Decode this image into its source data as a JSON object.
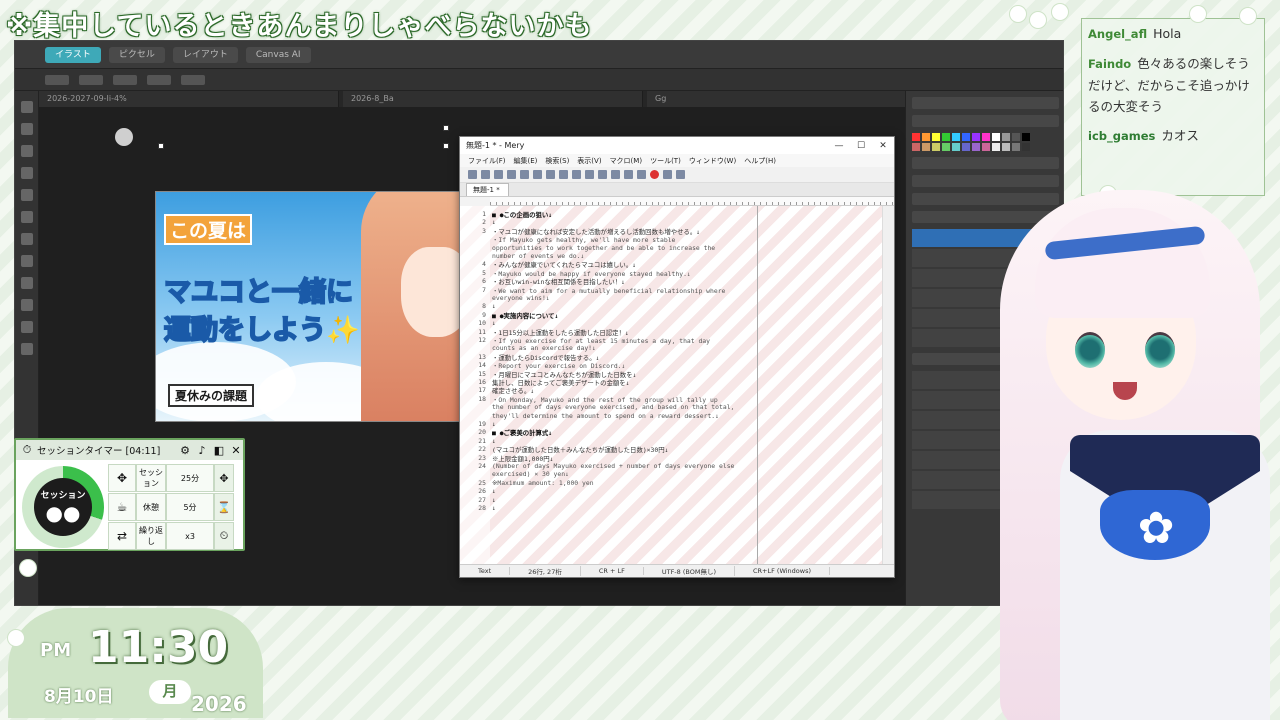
{
  "banner": "※集中しているときあんまりしゃべらないかも",
  "app": {
    "tabs": [
      "イラスト",
      "ピクセル",
      "レイアウト",
      "Canvas AI"
    ],
    "doc_tabs": [
      "2026-2027-09-Ii-4%",
      "2026-8_Ba",
      "Gg"
    ]
  },
  "artwork": {
    "line1": "この夏は",
    "line2": "マユコと一緒に",
    "line3": "運動をしよう✨",
    "tag": "夏休みの課題"
  },
  "editor": {
    "title": "無題-1 * - Mery",
    "menu": [
      "ファイル(F)",
      "編集(E)",
      "検索(S)",
      "表示(V)",
      "マクロ(M)",
      "ツール(T)",
      "ウィンドウ(W)",
      "ヘルプ(H)"
    ],
    "tab": "無題-1 *",
    "lines": [
      {
        "n": "1",
        "t": "■ ●この企画の狙い↓",
        "k": "h"
      },
      {
        "n": "2",
        "t": "↓",
        "k": ""
      },
      {
        "n": "3",
        "t": "・マユコが健康になれば安定した活動が増えるし活動回数も増やせる。↓",
        "k": ""
      },
      {
        "n": "",
        "t": "  ・If Mayuko gets healthy, we'll have more stable",
        "k": "en"
      },
      {
        "n": "",
        "t": "opportunities to work together and be able to increase the",
        "k": "en"
      },
      {
        "n": "",
        "t": "number of events we do.↓",
        "k": "en"
      },
      {
        "n": "4",
        "t": "・みんなが健康でいてくれたらマユコは嬉しい。↓",
        "k": ""
      },
      {
        "n": "5",
        "t": "  ・Mayuko would be happy if everyone stayed healthy.↓",
        "k": "en"
      },
      {
        "n": "6",
        "t": "・お互いwin-winな相互関係を目指したい！↓",
        "k": ""
      },
      {
        "n": "7",
        "t": "  ・We want to aim for a mutually beneficial relationship where",
        "k": "en"
      },
      {
        "n": "",
        "t": "everyone wins!↓",
        "k": "en"
      },
      {
        "n": "8",
        "t": "↓",
        "k": ""
      },
      {
        "n": "9",
        "t": "■ ●実施内容について↓",
        "k": "h"
      },
      {
        "n": "10",
        "t": "↓",
        "k": ""
      },
      {
        "n": "11",
        "t": "・1日15分以上運動をしたら運動した日認定！↓",
        "k": ""
      },
      {
        "n": "12",
        "t": "  ・If you exercise for at least 15 minutes a day, that day",
        "k": "en"
      },
      {
        "n": "",
        "t": "counts as an exercise day!↓",
        "k": "en"
      },
      {
        "n": "13",
        "t": "・運動したらDiscordで報告する。↓",
        "k": ""
      },
      {
        "n": "14",
        "t": "  ・Report your exercise on Discord.↓",
        "k": "en"
      },
      {
        "n": "15",
        "t": "・月曜日にマユコとみんなたちが運動した日数を↓",
        "k": ""
      },
      {
        "n": "16",
        "t": "集計し、日数によってご褒美デザートの金額を↓",
        "k": ""
      },
      {
        "n": "17",
        "t": "確定させる。↓",
        "k": ""
      },
      {
        "n": "18",
        "t": "  ・On Monday, Mayuko and the rest of the group will tally up",
        "k": "en"
      },
      {
        "n": "",
        "t": "the number of days everyone exercised, and based on that total,",
        "k": "en"
      },
      {
        "n": "",
        "t": "they'll determine the amount to spend on a reward dessert.↓",
        "k": "en"
      },
      {
        "n": "19",
        "t": "↓",
        "k": ""
      },
      {
        "n": "20",
        "t": "■ ●ご褒美の計算式↓",
        "k": "h"
      },
      {
        "n": "21",
        "t": "↓",
        "k": ""
      },
      {
        "n": "22",
        "t": "(マユコが運動した日数＋みんなたちが運動した日数)×30円↓",
        "k": ""
      },
      {
        "n": "23",
        "t": "※上限金額1,000円↓",
        "k": ""
      },
      {
        "n": "24",
        "t": "(Number of days Mayuko exercised + number of days everyone else",
        "k": "en"
      },
      {
        "n": "",
        "t": "exercised) × 30 yen↓",
        "k": "en"
      },
      {
        "n": "25",
        "t": "※Maximum amount: 1,000 yen",
        "k": "en"
      },
      {
        "n": "26",
        "t": "↓",
        "k": ""
      },
      {
        "n": "27",
        "t": "↓",
        "k": ""
      },
      {
        "n": "28",
        "t": "↓",
        "k": ""
      }
    ],
    "status": [
      "Text",
      "26行, 27桁",
      "CR + LF",
      "UTF-8 (BOM無し)",
      "CR+LF (Windows)"
    ]
  },
  "timer": {
    "title": "セッションタイマー [04:11]",
    "ring_label": "セッション",
    "progress_fraction": 0.3,
    "rows": [
      {
        "label": "セッション",
        "value": "25分"
      },
      {
        "label": "休憩",
        "value": "5分"
      },
      {
        "label": "繰り返し",
        "value": "x3"
      }
    ]
  },
  "clock": {
    "ampm": "PM",
    "time": "11:30",
    "date": "8月10日",
    "dow": "月",
    "year": "2026"
  },
  "chat": [
    {
      "name": "Angel_afl",
      "text": "Hola"
    },
    {
      "name": "Faindo",
      "text": "色々あるの楽しそうだけど、だからこそ追っかけるの大変そう"
    },
    {
      "name": "icb_games",
      "text": "カオス"
    }
  ],
  "colors": {
    "accent_green": "#3bbf4b",
    "frame_green": "#6aa35e",
    "chat_name": "#3f8a36"
  }
}
